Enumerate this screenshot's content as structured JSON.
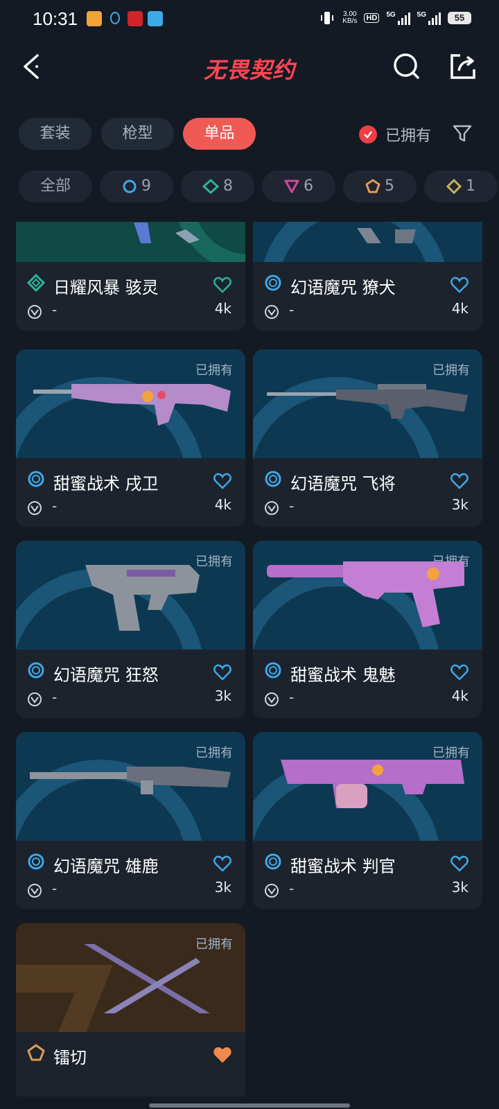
{
  "status_bar": {
    "time": "10:31",
    "net_speed": "3.00",
    "net_unit": "KB/s",
    "hd_label": "HD",
    "signal1_label": "5G",
    "signal2_label": "5G",
    "battery": "55"
  },
  "header": {
    "title": "无畏契约",
    "title_color": "#ff4655"
  },
  "tabs": [
    {
      "label": "套装",
      "active": false
    },
    {
      "label": "枪型",
      "active": false
    },
    {
      "label": "单品",
      "active": true
    }
  ],
  "owned_filter": {
    "label": "已拥有",
    "checked": true
  },
  "tier_chips": [
    {
      "label": "全部",
      "icon": null
    },
    {
      "label": "9",
      "icon": "circle-tier-icon",
      "color": "#3fa9e8"
    },
    {
      "label": "8",
      "icon": "diamond-tier-icon",
      "color": "#2bb39a"
    },
    {
      "label": "6",
      "icon": "triangle-tier-icon",
      "color": "#d1479f"
    },
    {
      "label": "5",
      "icon": "pentagon-tier-icon",
      "color": "#e39a57"
    },
    {
      "label": "1",
      "icon": "square-tier-icon",
      "color": "#c7b35a"
    }
  ],
  "items": [
    {
      "name": "日耀风暴 骇灵",
      "price": "-",
      "likes": "4k",
      "owned": "",
      "tier": "diamond",
      "liked": false
    },
    {
      "name": "幻语魔咒 獠犬",
      "price": "-",
      "likes": "4k",
      "owned": "",
      "tier": "circle",
      "liked": false
    },
    {
      "name": "甜蜜战术 戌卫",
      "price": "-",
      "likes": "4k",
      "owned": "已拥有",
      "tier": "circle",
      "liked": false
    },
    {
      "name": "幻语魔咒 飞将",
      "price": "-",
      "likes": "3k",
      "owned": "已拥有",
      "tier": "circle",
      "liked": false
    },
    {
      "name": "幻语魔咒 狂怒",
      "price": "-",
      "likes": "3k",
      "owned": "已拥有",
      "tier": "circle",
      "liked": false
    },
    {
      "name": "甜蜜战术 鬼魅",
      "price": "-",
      "likes": "4k",
      "owned": "已拥有",
      "tier": "circle",
      "liked": false
    },
    {
      "name": "幻语魔咒 雄鹿",
      "price": "-",
      "likes": "3k",
      "owned": "已拥有",
      "tier": "circle",
      "liked": false
    },
    {
      "name": "甜蜜战术 判官",
      "price": "-",
      "likes": "3k",
      "owned": "已拥有",
      "tier": "circle",
      "liked": false
    },
    {
      "name": "镭切",
      "price": "",
      "likes": "",
      "owned": "已拥有",
      "tier": "pentagon",
      "liked": true
    }
  ],
  "colors": {
    "accent": "#f05a55",
    "heart_default": "#3fa9e8",
    "heart_liked": "#f08a4b",
    "tier_circle": "#3fa9e8",
    "tier_diamond": "#2bb39a",
    "tier_pentagon": "#e39a57"
  }
}
